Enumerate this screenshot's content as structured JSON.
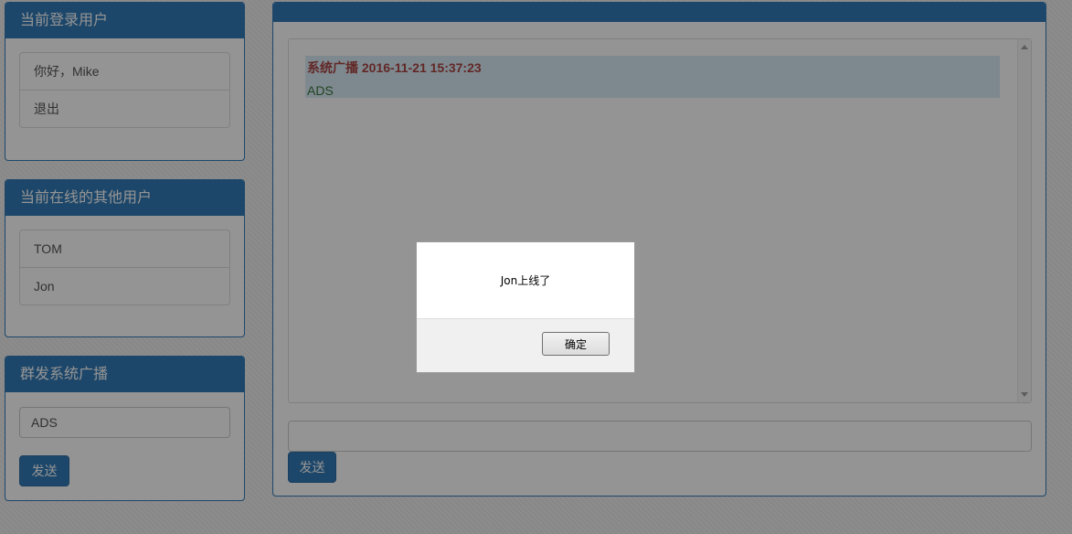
{
  "current_user_panel": {
    "title": "当前登录用户",
    "items": [
      {
        "label": "你好，Mike"
      },
      {
        "label": "退出"
      }
    ]
  },
  "online_users_panel": {
    "title": "当前在线的其他用户",
    "items": [
      {
        "label": "TOM"
      },
      {
        "label": "Jon"
      }
    ]
  },
  "broadcast_panel": {
    "title": "群发系统广播",
    "input_value": "ADS",
    "send_label": "发送"
  },
  "chat_panel": {
    "title": "",
    "messages": [
      {
        "header": "系统广播 2016-11-21 15:37:23",
        "body": "ADS"
      }
    ],
    "input_value": "",
    "send_label": "发送"
  },
  "alert_dialog": {
    "message": "Jon上线了",
    "ok_label": "确定"
  },
  "colors": {
    "primary": "#337ab7",
    "message_bg": "#d9edf7",
    "message_header": "#a94442",
    "message_body": "#3c763d"
  }
}
